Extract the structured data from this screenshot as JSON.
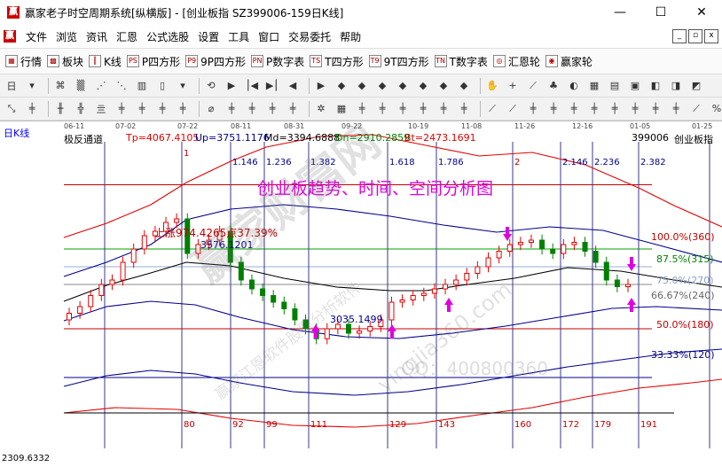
{
  "window": {
    "title": "赢家老子时空周期系统[纵横版] - [创业板指 SZ399006-159日K线]",
    "icon_char": "赢",
    "controls": [
      "—",
      "☐",
      "✕"
    ]
  },
  "menubar": {
    "items": [
      "文件",
      "浏览",
      "资讯",
      "汇恩",
      "公式选股",
      "设置",
      "工具",
      "窗口",
      "交易委托",
      "帮助"
    ],
    "mdi_controls": [
      "_",
      "▫",
      "x"
    ]
  },
  "toolbar1": {
    "items": [
      {
        "icon": "grid-icon",
        "glyph": "▦",
        "label": "行情"
      },
      {
        "icon": "blocks-icon",
        "glyph": "▩",
        "label": "板块"
      },
      {
        "icon": "kline-icon",
        "glyph": "║",
        "label": "K线"
      },
      {
        "icon": "ps-icon",
        "glyph": "PS",
        "label": "P四方形"
      },
      {
        "icon": "p9-icon",
        "glyph": "P9",
        "label": "9P四方形"
      },
      {
        "icon": "pn-icon",
        "glyph": "PN",
        "label": "P数字表"
      },
      {
        "icon": "ts-icon",
        "glyph": "TS",
        "label": "T四方形"
      },
      {
        "icon": "t9-icon",
        "glyph": "T9",
        "label": "9T四方形"
      },
      {
        "icon": "tn-icon",
        "glyph": "TN",
        "label": "T数字表"
      },
      {
        "icon": "huien-wheel-icon",
        "glyph": "◎",
        "label": "汇恩轮"
      },
      {
        "icon": "yingjia-wheel-icon",
        "glyph": "◉",
        "label": "赢家轮"
      }
    ]
  },
  "toolbar2": {
    "buttons": [
      "日",
      "▾",
      "⌘",
      "▒",
      "⋰",
      "⋱",
      "▥",
      "▯",
      "▾",
      "⟲",
      "▶",
      "⎮◀",
      "▶⎮",
      "◀",
      "▶",
      "◆",
      "◆",
      "◆",
      "◆",
      "◆",
      "◆",
      "◆",
      "✋",
      "+",
      "⟋",
      "♣",
      "◐",
      "▦",
      "▤",
      "▣",
      "◧",
      "◨",
      "◩"
    ]
  },
  "toolbar3": {
    "buttons": [
      "⤡",
      "╪",
      "╫",
      "╬",
      "亖",
      "╪",
      "╪",
      "╪",
      "╪",
      "⌀",
      "╪",
      "╪",
      "╪",
      "╪",
      "✲",
      "▦",
      "╪",
      "╪",
      "╪",
      "╪",
      "╪",
      "╪",
      "⟋",
      "⟋",
      "╪",
      "╪",
      "╪",
      "╪",
      "╪",
      "╪",
      "╪",
      "╪",
      "⟋",
      "%",
      "⟋"
    ]
  },
  "chart": {
    "period_label": "日K线",
    "indicator_name": "极反通道",
    "indicator_params": [
      "Tp=4067.4105",
      "Up=3751.1176",
      "Md=3394.6888",
      "Dn=2910.2859",
      "Bt=2473.1691"
    ],
    "code": "399006",
    "name": "创业板指",
    "annotation_title": "创业板趋势、时间、空间分析图",
    "date_ticks": [
      "06-11",
      "07-02",
      "07-22",
      "08-11",
      "08-31",
      "09-22",
      "10-19",
      "11-08",
      "11-26",
      "12-16",
      "01-05",
      "01-25"
    ],
    "time_cycle_marks_top": [
      "1",
      "1.146",
      "1.236",
      "1.382",
      "1.618",
      "1.786",
      "2",
      "2.146",
      "2.236",
      "2.382"
    ],
    "bar_counts_bottom": [
      "80",
      "92",
      "99",
      "111",
      "129",
      "143",
      "160",
      "172",
      "179",
      "191"
    ],
    "high_note": "上涨974.4265点37.39%",
    "high_value": "3576.1201",
    "low_value": "3035.1499",
    "bottom_value": "2309.6332",
    "levels": [
      "100.0%(360)",
      "87.5%(315)",
      "75.0%(270)",
      "66.67%(240)",
      "50.0%(180)",
      "33.33%(120)"
    ],
    "watermark_brand": "赢家财富网",
    "watermark_cn": "赢家江恩软件股票分析软件",
    "watermark_url": "yingjia360.com",
    "watermark_qq": "QQ：400800360",
    "colors": {
      "candle_up": "#e60000",
      "candle_down": "#008000",
      "upper_channel": "#e60000",
      "mid_channel": "#000080",
      "inner_channel": "#000000",
      "annotation": "#e000e0",
      "level_red": "#c00000",
      "level_blue": "#00008b"
    }
  },
  "chart_data": {
    "type": "candlestick",
    "title": "创业板趋势、时间、空间分析图",
    "series_name": "创业板指",
    "x_ticks": [
      "06-11",
      "07-02",
      "07-22",
      "08-11",
      "08-31",
      "09-22",
      "10-19",
      "11-08",
      "11-26",
      "12-16",
      "01-05",
      "01-25"
    ],
    "close_path": [
      3150,
      3180,
      3230,
      3280,
      3300,
      3380,
      3440,
      3500,
      3520,
      3560,
      3576,
      3420,
      3460,
      3480,
      3520,
      3380,
      3300,
      3260,
      3230,
      3200,
      3170,
      3120,
      3080,
      3035,
      3080,
      3100,
      3060,
      3070,
      3090,
      3120,
      3200,
      3210,
      3230,
      3240,
      3260,
      3280,
      3300,
      3330,
      3360,
      3400,
      3430,
      3460,
      3470,
      3480,
      3440,
      3420,
      3460,
      3470,
      3430,
      3380,
      3300,
      3270,
      3280
    ],
    "levels": [
      {
        "label": "100.0%(360)",
        "value": 3730
      },
      {
        "label": "87.5%(315)",
        "value": 3440
      },
      {
        "label": "75.0%(270)",
        "value": 3360
      },
      {
        "label": "66.67%(240)",
        "value": 3280
      },
      {
        "label": "50.0%(180)",
        "value": 3080
      },
      {
        "label": "33.33%(120)",
        "value": 2860
      }
    ],
    "ylim": [
      2309.6332,
      4067.4105
    ]
  }
}
